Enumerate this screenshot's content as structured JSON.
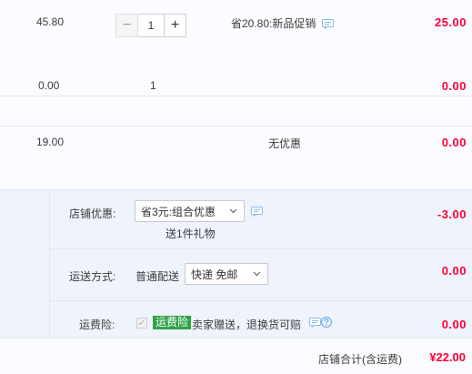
{
  "items": [
    {
      "unit_price": "45.80",
      "quantity": "1",
      "stepper_minus": "−",
      "stepper_plus": "+",
      "promo": "省20.80:新品促销",
      "subtotal": "25.00"
    },
    {
      "unit_price": "0.00",
      "quantity": "1",
      "promo": "",
      "subtotal": "0.00"
    },
    {
      "unit_price": "19.00",
      "quantity": "",
      "promo": "无优惠",
      "subtotal": "0.00"
    }
  ],
  "shop": {
    "discount_label": "店铺优惠:",
    "discount_select": "省3元:组合优惠",
    "discount_gift": "送1件礼物",
    "discount_amount": "-3.00",
    "shipping_label": "运送方式:",
    "shipping_type": "普通配送",
    "shipping_select": "快递 免邮",
    "shipping_amount": "0.00",
    "insurance_label": "运费险:",
    "insurance_tag": "运费险",
    "insurance_text": "卖家赠送，退换货可赔",
    "insurance_amount": "0.00"
  },
  "total": {
    "label": "店铺合计(含运费)",
    "amount": "¥22.00"
  },
  "colors": {
    "price_red": "#ff0036",
    "shop_bg": "#eef3fc",
    "insurance_green": "#2fa346",
    "icon_blue": "#5aa0e6"
  }
}
